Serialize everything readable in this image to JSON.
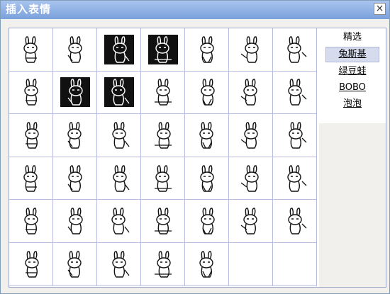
{
  "dialog": {
    "title": "插入表情",
    "close_glyph": "×"
  },
  "categories": [
    {
      "label": "精选",
      "selected": false,
      "underline": false
    },
    {
      "label": "兔斯基",
      "selected": true,
      "underline": true
    },
    {
      "label": "绿豆蛙",
      "selected": false,
      "underline": true
    },
    {
      "label": "BOBO",
      "selected": false,
      "underline": true
    },
    {
      "label": "泡泡",
      "selected": false,
      "underline": true
    }
  ],
  "emoticons": {
    "icon": "tuzki-rabbit-icon",
    "count": 40,
    "dark_variants": [
      2,
      3,
      8,
      9
    ],
    "empty_cells": 2
  }
}
